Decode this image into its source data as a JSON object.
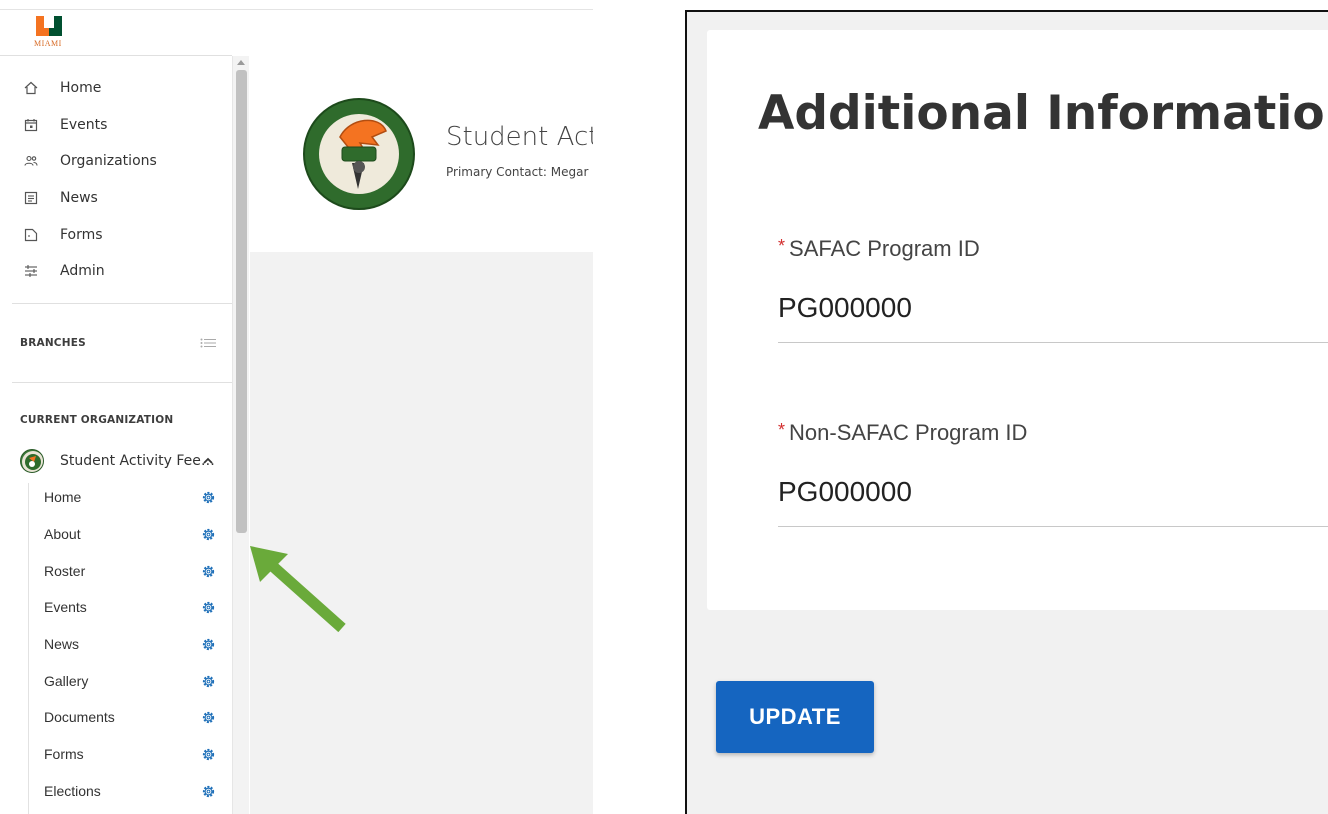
{
  "app": {
    "logo_text": "MIAMI"
  },
  "sidebar": {
    "nav_items": [
      {
        "label": "Home",
        "icon": "home-icon"
      },
      {
        "label": "Events",
        "icon": "calendar-icon"
      },
      {
        "label": "Organizations",
        "icon": "people-icon"
      },
      {
        "label": "News",
        "icon": "news-icon"
      },
      {
        "label": "Forms",
        "icon": "form-icon"
      },
      {
        "label": "Admin",
        "icon": "sliders-icon"
      }
    ],
    "branches_title": "BRANCHES",
    "current_org_title": "CURRENT ORGANIZATION",
    "current_org": {
      "name": "Student Activity Fee…",
      "sub_items": [
        {
          "label": "Home"
        },
        {
          "label": "About"
        },
        {
          "label": "Roster"
        },
        {
          "label": "Events"
        },
        {
          "label": "News"
        },
        {
          "label": "Gallery"
        },
        {
          "label": "Documents"
        },
        {
          "label": "Forms"
        },
        {
          "label": "Elections"
        }
      ]
    }
  },
  "main": {
    "org_title": "Student Act",
    "primary_contact": "Primary Contact: Megar"
  },
  "form": {
    "title": "Additional Information",
    "fields": [
      {
        "label": "SAFAC Program ID",
        "value": "PG000000",
        "required": "*"
      },
      {
        "label": "Non-SAFAC Program ID",
        "value": "PG000000",
        "required": "*"
      }
    ],
    "update_label": "UPDATE"
  },
  "colors": {
    "accent_blue": "#1565c0",
    "gear_blue": "#1e6fb8",
    "arrow_green": "#6aaa3a",
    "miami_orange": "#f47321",
    "miami_green": "#005030"
  }
}
